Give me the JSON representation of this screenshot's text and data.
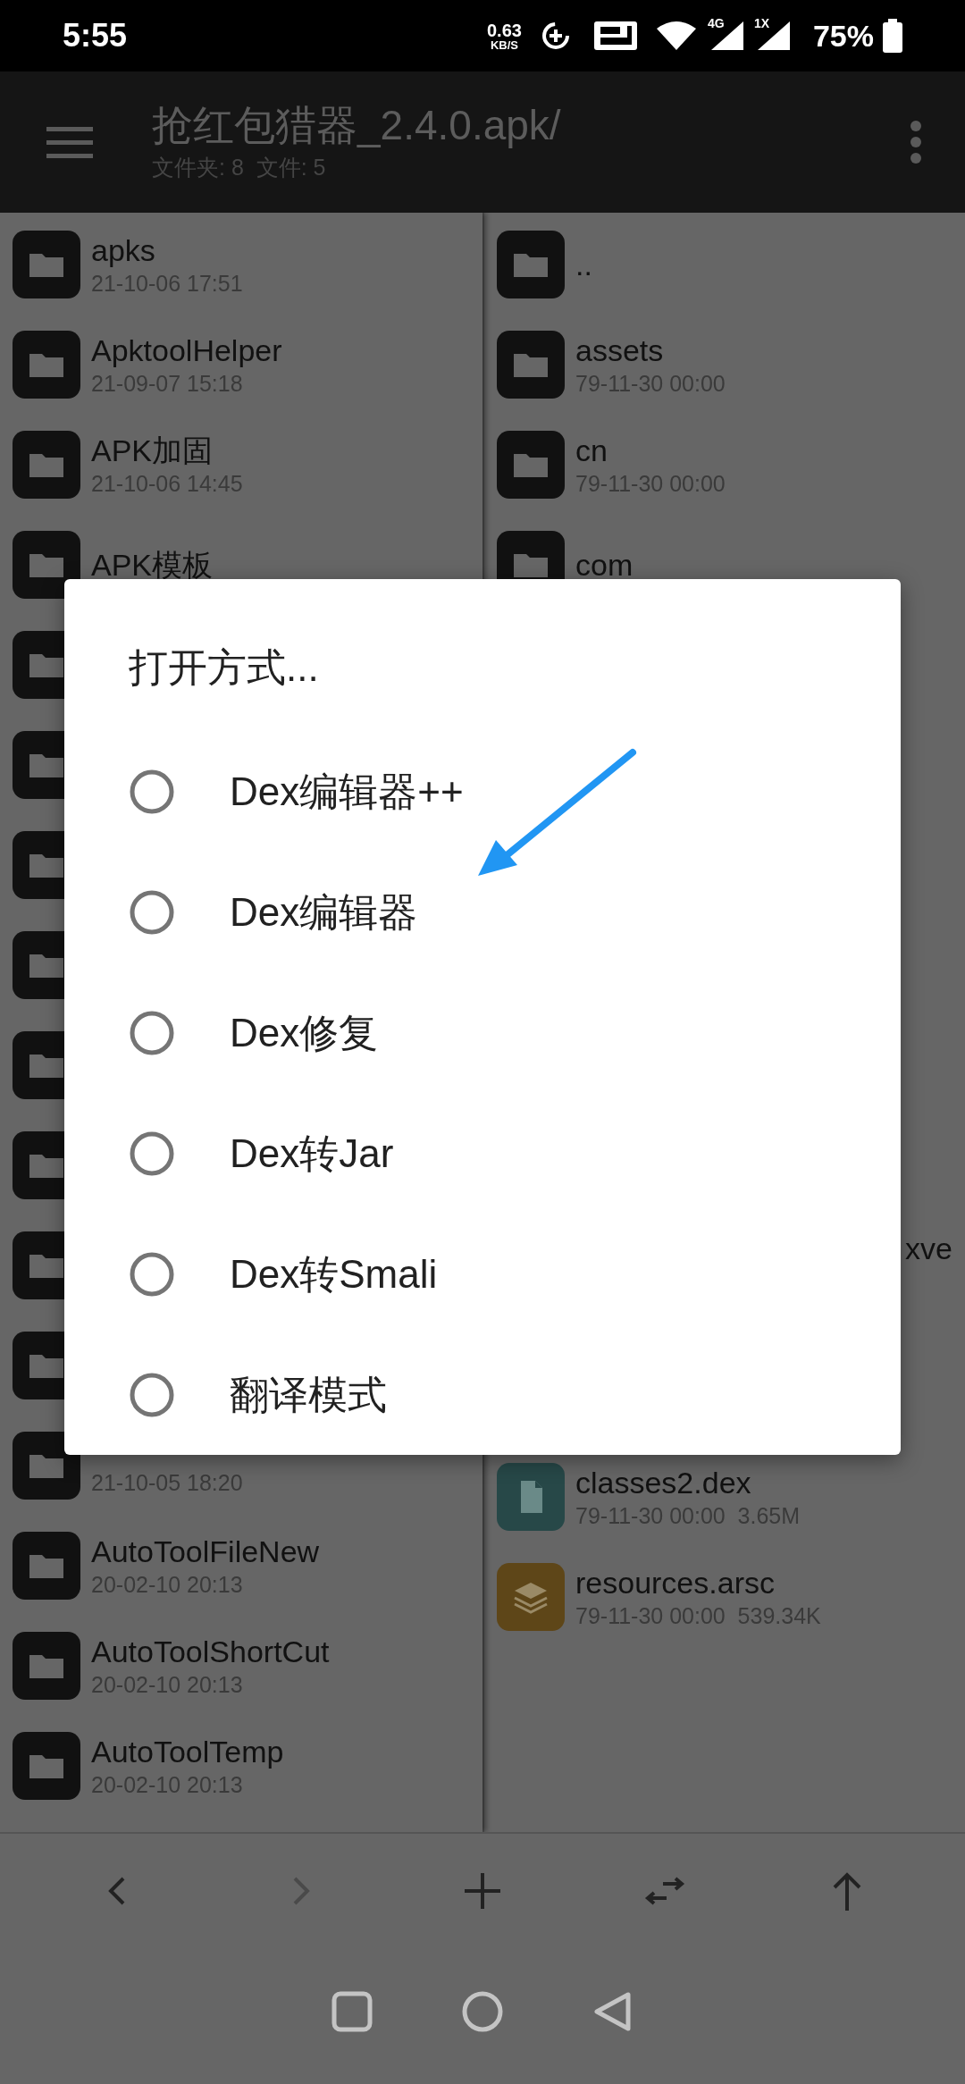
{
  "status_bar": {
    "time": "5:55",
    "net_speed": "0.63",
    "net_unit": "KB/S",
    "mobile_1": "4G",
    "mobile_2": "1X",
    "battery": "75%"
  },
  "app_bar": {
    "title": "抢红包猎器_2.4.0.apk/",
    "subtitle": "文件夹: 8  文件: 5"
  },
  "left_pane": {
    "items": [
      {
        "kind": "folder",
        "name": "apks",
        "meta": "21-10-06 17:51"
      },
      {
        "kind": "folder",
        "name": "ApktoolHelper",
        "meta": "21-09-07 15:18"
      },
      {
        "kind": "folder",
        "name": "APK加固",
        "meta": "21-10-06 14:45"
      },
      {
        "kind": "folder",
        "name": "APK模板"
      },
      {
        "kind": "folder"
      },
      {
        "kind": "folder"
      },
      {
        "kind": "folder"
      },
      {
        "kind": "folder"
      },
      {
        "kind": "folder"
      },
      {
        "kind": "folder"
      },
      {
        "kind": "folder"
      },
      {
        "kind": "folder"
      },
      {
        "kind": "folder",
        "meta": "21-10-05 18:20"
      },
      {
        "kind": "folder",
        "name": "AutoToolFileNew",
        "meta": "20-02-10 20:13"
      },
      {
        "kind": "folder",
        "name": "AutoToolShortCut",
        "meta": "20-02-10 20:13"
      },
      {
        "kind": "folder",
        "name": "AutoToolTemp",
        "meta": "20-02-10 20:13"
      }
    ]
  },
  "right_pane": {
    "items": [
      {
        "kind": "folder",
        "name": ".."
      },
      {
        "kind": "folder",
        "name": "assets",
        "meta": "79-11-30 00:00"
      },
      {
        "kind": "folder",
        "name": "cn",
        "meta": "79-11-30 00:00"
      },
      {
        "kind": "folder",
        "name": "com"
      },
      {
        "kind": "covered"
      },
      {
        "kind": "covered"
      },
      {
        "kind": "covered"
      },
      {
        "kind": "covered"
      },
      {
        "kind": "covered"
      },
      {
        "kind": "covered"
      },
      {
        "kind": "covered",
        "name": "xve"
      },
      {
        "kind": "covered"
      },
      {
        "kind": "dex",
        "name": "classes2.dex",
        "meta": "79-11-30 00:00  3.65M"
      },
      {
        "kind": "arsc",
        "name": "resources.arsc",
        "meta": "79-11-30 00:00  539.34K"
      }
    ]
  },
  "dialog": {
    "title": "打开方式...",
    "options": [
      {
        "label": "Dex编辑器++",
        "selected": false
      },
      {
        "label": "Dex编辑器",
        "selected": false
      },
      {
        "label": "Dex修复",
        "selected": false
      },
      {
        "label": "Dex转Jar",
        "selected": false
      },
      {
        "label": "Dex转Smali",
        "selected": false
      },
      {
        "label": "翻译模式",
        "selected": false
      }
    ]
  },
  "toolbar": [
    {
      "kind": "back",
      "disabled": false
    },
    {
      "kind": "forward",
      "disabled": true
    },
    {
      "kind": "add",
      "disabled": false
    },
    {
      "kind": "swap",
      "disabled": false
    },
    {
      "kind": "up",
      "disabled": false
    }
  ]
}
